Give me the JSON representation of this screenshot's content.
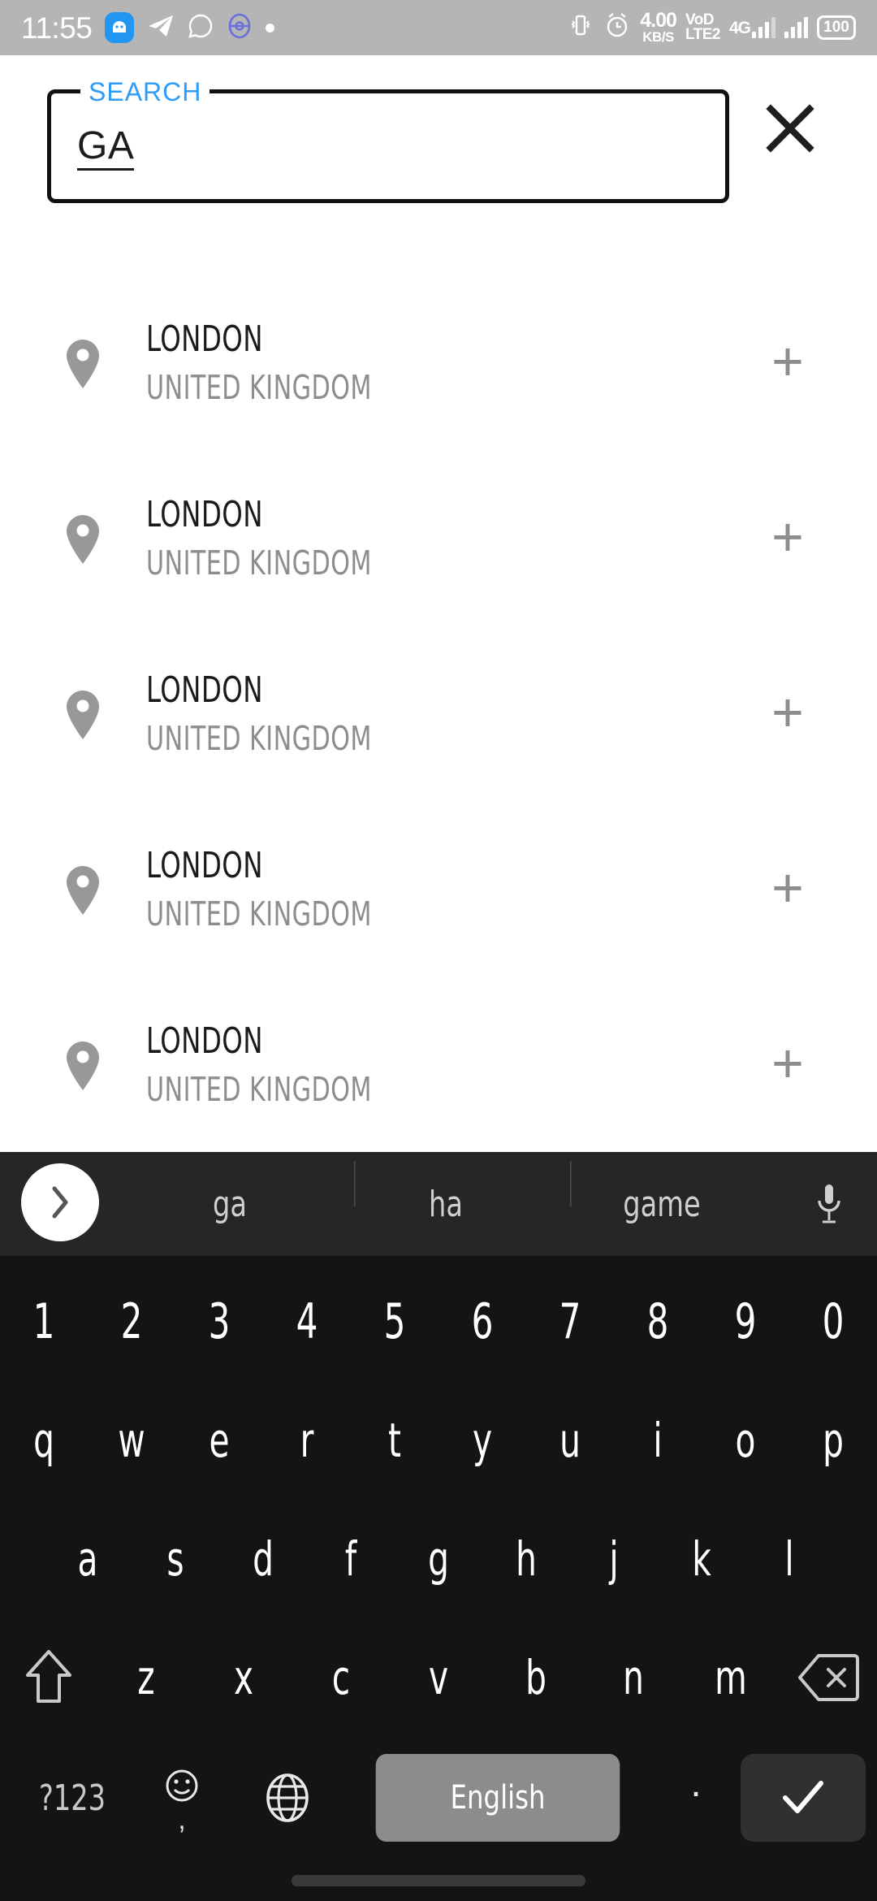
{
  "status_bar": {
    "time": "11:55",
    "network_speed_value": "4.00",
    "network_speed_unit": "KB/S",
    "volte_line1": "VoD",
    "volte_line2": "LTE2",
    "mobile_network": "4G",
    "battery": "100",
    "icons": [
      "android-head-icon",
      "telegram-icon",
      "whatsapp-icon",
      "pokeball-icon",
      "dot-icon",
      "vibrate-icon",
      "alarm-icon",
      "signal-icon",
      "battery-icon"
    ]
  },
  "search": {
    "label": "SEARCH",
    "value": "GA",
    "placeholder": "SEARCH",
    "clear_label": "×",
    "label_color": "#2e9bf5"
  },
  "results": {
    "items": [
      {
        "title": "LONDON",
        "subtitle": "UNITED KINGDOM",
        "add_label": "+"
      },
      {
        "title": "LONDON",
        "subtitle": "UNITED KINGDOM",
        "add_label": "+"
      },
      {
        "title": "LONDON",
        "subtitle": "UNITED KINGDOM",
        "add_label": "+"
      },
      {
        "title": "LONDON",
        "subtitle": "UNITED KINGDOM",
        "add_label": "+"
      },
      {
        "title": "LONDON",
        "subtitle": "UNITED KINGDOM",
        "add_label": "+"
      }
    ]
  },
  "keyboard": {
    "suggestions": [
      "ga",
      "ha",
      "game"
    ],
    "expand_icon": "chevron-right-icon",
    "mic_icon": "microphone-icon",
    "row_numbers": [
      "1",
      "2",
      "3",
      "4",
      "5",
      "6",
      "7",
      "8",
      "9",
      "0"
    ],
    "row_top": [
      "q",
      "w",
      "e",
      "r",
      "t",
      "y",
      "u",
      "i",
      "o",
      "p"
    ],
    "row_mid": [
      "a",
      "s",
      "d",
      "f",
      "g",
      "h",
      "j",
      "k",
      "l"
    ],
    "row_bottom": [
      "z",
      "x",
      "c",
      "v",
      "b",
      "n",
      "m"
    ],
    "shift_label": "shift-icon",
    "backspace_label": "backspace-icon",
    "symbols_key": "?123",
    "emoji_comma": ",",
    "globe_key": "globe-icon",
    "space_label": "English",
    "period_key": ".",
    "enter_key": "check-icon"
  },
  "colors": {
    "statusbar_bg": "#b5b5b5",
    "keyboard_bg": "#141414",
    "suggestion_bg": "#262626",
    "space_key_bg": "#8c8c8c",
    "accent_blue": "#2e9bf5"
  }
}
